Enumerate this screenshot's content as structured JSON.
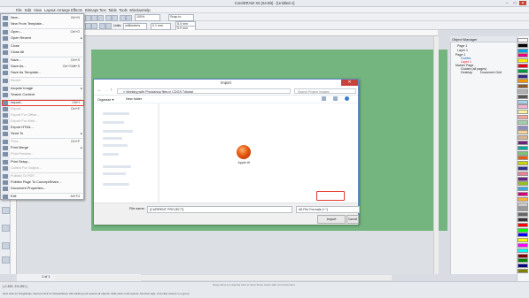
{
  "titlebar": {
    "title": "CorelDRAW X6 (64-Bit) - [Untitled-1]",
    "minimize": "–",
    "maximize": "□",
    "close": "✕"
  },
  "menubar": {
    "items": [
      "File",
      "Edit",
      "View",
      "Layout",
      "Arrange",
      "Effects",
      "Bitmaps",
      "Text",
      "Table",
      "Tools",
      "Window",
      "Help"
    ]
  },
  "toolbar": {
    "zoom": "100%",
    "snap_to": "Snap to",
    "units_label": "Units:",
    "units_value": "millimeters",
    "nudge": "0.1 mm",
    "dup_x": "5.0 mm",
    "dup_y": "5.0 mm"
  },
  "file_menu": {
    "items": [
      {
        "label": "New...",
        "shortcut": "Ctrl+N",
        "disabled": false
      },
      {
        "label": "New From Template...",
        "shortcut": "",
        "disabled": false
      },
      {
        "label": "Open...",
        "shortcut": "Ctrl+O",
        "disabled": false
      },
      {
        "label": "Open Recent",
        "shortcut": "",
        "disabled": false,
        "submenu": true
      },
      {
        "label": "Close",
        "shortcut": "",
        "disabled": false
      },
      {
        "label": "Close All",
        "shortcut": "",
        "disabled": false
      },
      {
        "label": "Save...",
        "shortcut": "Ctrl+S",
        "disabled": false
      },
      {
        "label": "Save As...",
        "shortcut": "Ctrl+Shift+S",
        "disabled": false
      },
      {
        "label": "Save As Template...",
        "shortcut": "",
        "disabled": false
      },
      {
        "label": "Revert",
        "shortcut": "",
        "disabled": true
      },
      {
        "label": "Acquire Image",
        "shortcut": "",
        "disabled": false,
        "submenu": true
      },
      {
        "label": "Search Content",
        "shortcut": "",
        "disabled": false
      },
      {
        "label": "Import...",
        "shortcut": "Ctrl+I",
        "disabled": false,
        "highlighted": true
      },
      {
        "label": "Export...",
        "shortcut": "Ctrl+E",
        "disabled": true
      },
      {
        "label": "Export For Office...",
        "shortcut": "",
        "disabled": true
      },
      {
        "label": "Export For Web...",
        "shortcut": "",
        "disabled": true
      },
      {
        "label": "Export HTML...",
        "shortcut": "",
        "disabled": false
      },
      {
        "label": "Send To",
        "shortcut": "",
        "disabled": false,
        "submenu": true
      },
      {
        "label": "Print...",
        "shortcut": "Ctrl+P",
        "disabled": true
      },
      {
        "label": "Print Merge",
        "shortcut": "",
        "disabled": false,
        "submenu": true
      },
      {
        "label": "Print Preview...",
        "shortcut": "",
        "disabled": true
      },
      {
        "label": "Print Setup...",
        "shortcut": "",
        "disabled": false
      },
      {
        "label": "Collect For Output...",
        "shortcut": "",
        "disabled": true
      },
      {
        "label": "Publish To PDF...",
        "shortcut": "",
        "disabled": true
      },
      {
        "label": "Publish Page To ConceptShare...",
        "shortcut": "",
        "disabled": false
      },
      {
        "label": "Document Properties...",
        "shortcut": "",
        "disabled": false
      },
      {
        "label": "Exit",
        "shortcut": "Alt+F4",
        "disabled": false
      }
    ]
  },
  "import_dialog": {
    "title": "Import",
    "close": "✕",
    "breadcrumb": "« Working with Photoshop files in CDGS Tutorial",
    "search_placeholder": "Search Project Images",
    "organize": "Organize ▾",
    "new_folder": "New folder",
    "file": {
      "name": "Apple.tif"
    },
    "file_name_label": "File name:",
    "file_name_value": "[CURRENT PROJECT]",
    "file_type_value": "All File Formats (*.*)",
    "import_button": "Import",
    "cancel_button": "Cancel"
  },
  "object_manager": {
    "title": "Object Manager",
    "page": "Page 1",
    "layer": "Layer 1",
    "tree": [
      "Page 1",
      "Guides",
      "Layer 1",
      "Master Page",
      "Guides (all pages)",
      "Desktop",
      "Document Grid"
    ]
  },
  "docnav": {
    "position": "1 of 1",
    "page_tab": "Page 1"
  },
  "status": {
    "coords": "(-2.459, 211.891 )",
    "hint": "Drag colors (or objects) here to store these colors with your document",
    "bottom": "Next click for Drag/Scale; Second click for Rotate/Skew; Dbl-clicking tool selects all objects; Shift+click multi-selects; Alt+click digs; Ctrl+click selects in a group"
  },
  "colors": {
    "page": "#74b57f",
    "highlight": "#e23a2d",
    "dialog_close": "#c7413d"
  },
  "palette": [
    "#ffffff",
    "#000000",
    "#00a0e6",
    "#e6007e",
    "#ffed00",
    "#e30613",
    "#009640",
    "#312783",
    "#f39200",
    "#8b5a2b",
    "#b2b2b2",
    "#575756",
    "#a3d3f0",
    "#f6b2cf",
    "#fff59b",
    "#f7a59b",
    "#9dd3a8",
    "#8d8cc4",
    "#fbd09a",
    "#d9b48f",
    "#6d2077",
    "#00a99d",
    "#7cc576",
    "#ea5b0c",
    "#c8d300",
    "#2e3192",
    "#ef7d95",
    "#662483",
    "#95c11f",
    "#36a9e1",
    "#d4007a",
    "#f9b233",
    "#cccccc",
    "#999999",
    "#666666",
    "#333333",
    "#ff0000",
    "#00ff00",
    "#0000ff",
    "#ffff00",
    "#ff00ff",
    "#00ffff",
    "#800000",
    "#008000",
    "#000080",
    "#808000"
  ]
}
